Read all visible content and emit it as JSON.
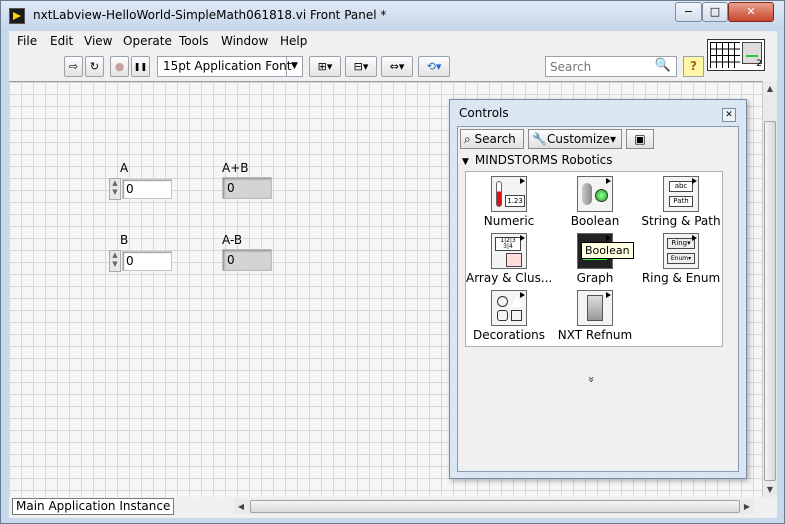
{
  "window": {
    "title": "nxtLabview-HelloWorld-SimpleMath061818.vi Front Panel *",
    "min_glyph": "−",
    "max_glyph": "□",
    "close_glyph": "✕"
  },
  "menu": {
    "items": [
      "File",
      "Edit",
      "View",
      "Operate",
      "Tools",
      "Window",
      "Help"
    ]
  },
  "toolbar": {
    "run_glyph": "⇨",
    "run_cont_glyph": "↻",
    "abort_glyph": "●",
    "pause_glyph": "❚❚",
    "font": "15pt Application Font",
    "search_placeholder": "Search",
    "search_glyph": "🔍",
    "help_glyph": "?",
    "connector_count": "2"
  },
  "panel": {
    "controls": [
      {
        "label": "A",
        "value": "0"
      },
      {
        "label": "B",
        "value": "0"
      }
    ],
    "indicators": [
      {
        "label": "A+B",
        "value": "0"
      },
      {
        "label": "A-B",
        "value": "0"
      }
    ]
  },
  "status": {
    "instance": "Main Application Instance"
  },
  "palette": {
    "title": "Controls",
    "close_glyph": "✕",
    "search_label": "Search",
    "customize_label": "Customize▾",
    "section": "MINDSTORMS Robotics",
    "items": [
      "Numeric",
      "Boolean",
      "String & Path",
      "Array & Clus...",
      "Graph",
      "Ring & Enum",
      "Decorations",
      "NXT Refnum"
    ],
    "tooltip": "Boolean",
    "more_glyph": "»"
  },
  "icons": {
    "numeric": "numeric-icon",
    "boolean": "boolean-icon",
    "graph": "graph-icon"
  }
}
